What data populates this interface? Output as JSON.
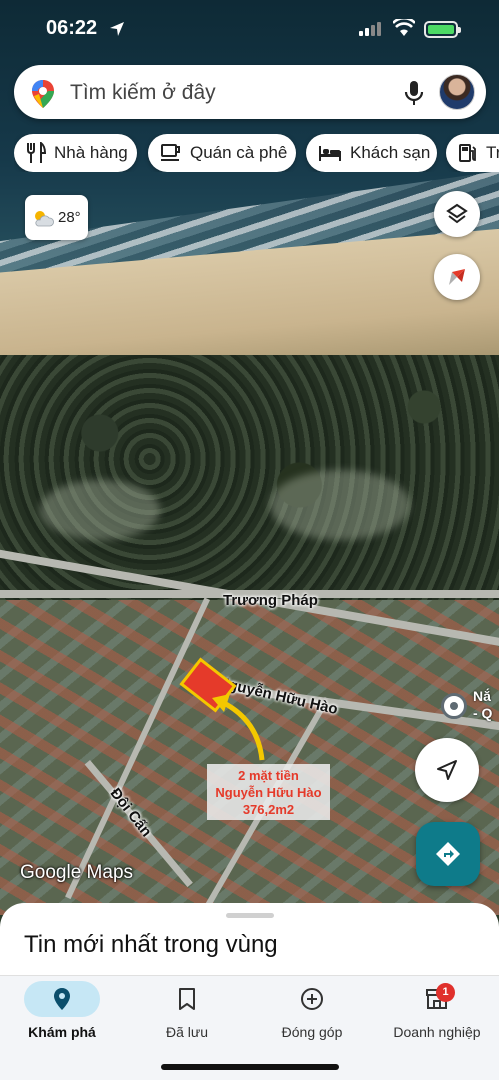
{
  "status_bar": {
    "time": "06:22"
  },
  "search": {
    "placeholder": "Tìm kiếm ở đây"
  },
  "chips": [
    {
      "label": "Nhà hàng",
      "icon": "fork-knife-icon"
    },
    {
      "label": "Quán cà phê",
      "icon": "coffee-icon"
    },
    {
      "label": "Khách sạn",
      "icon": "bed-icon"
    },
    {
      "label": "Tr",
      "icon": "gas-pump-icon"
    }
  ],
  "weather": {
    "temperature": "28°",
    "icon": "partly-cloudy-icon"
  },
  "map": {
    "roads": {
      "truong_phap": "Trương Pháp",
      "nguyen_huu_hao": "Nguyễn Hữu Hào",
      "doi_can": "Đội Cấn"
    },
    "annotation": {
      "line1": "2 mặt tiền",
      "line2": "Nguyễn Hữu Hào",
      "line3": "376,2m2"
    },
    "place": {
      "line1": "Nắ",
      "line2": "- Q"
    },
    "attribution": "Google Maps"
  },
  "sheet": {
    "title": "Tin mới nhất trong vùng"
  },
  "bottom_nav": {
    "items": [
      {
        "label": "Khám phá",
        "icon": "explore-pin-icon",
        "active": true
      },
      {
        "label": "Đã lưu",
        "icon": "bookmark-icon",
        "active": false
      },
      {
        "label": "Đóng góp",
        "icon": "add-circle-icon",
        "active": false
      },
      {
        "label": "Doanh nghiệp",
        "icon": "storefront-icon",
        "active": false
      }
    ],
    "badge": "1"
  },
  "colors": {
    "accent_nav": "#c6e7f5",
    "directions_button": "#0e7b8a",
    "plot_fill": "#e53a2a",
    "plot_border": "#f3c800"
  }
}
